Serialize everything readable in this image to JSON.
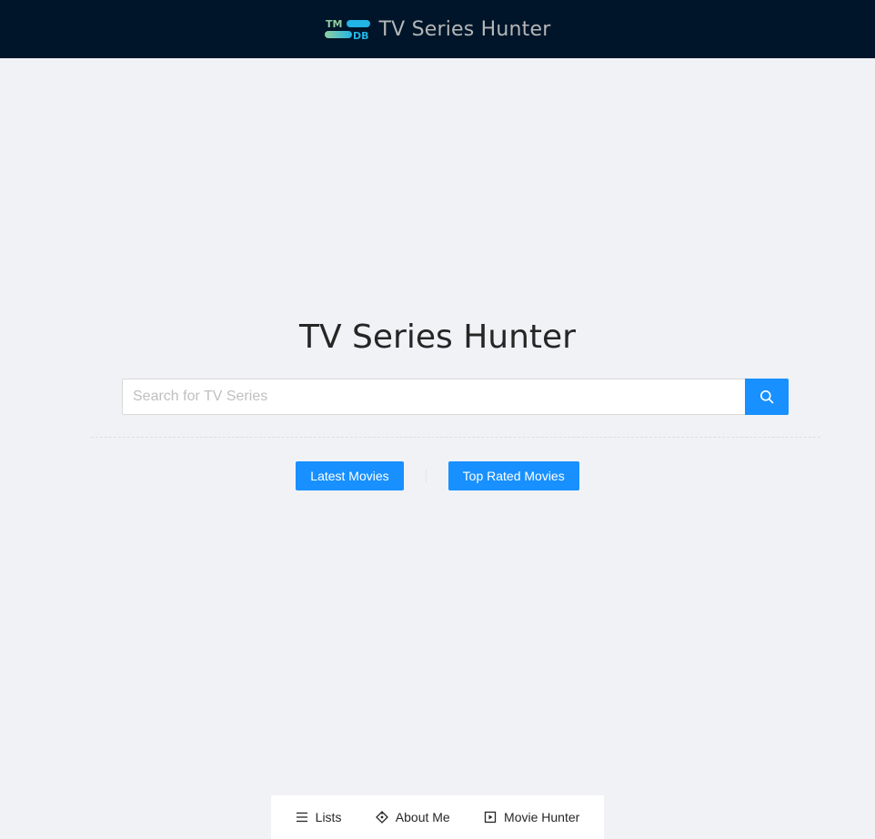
{
  "header": {
    "logo_top_text": "TM",
    "logo_bottom_text": "DB",
    "title": "TV Series Hunter"
  },
  "main": {
    "title": "TV Series Hunter",
    "search": {
      "placeholder": "Search for TV Series",
      "value": "",
      "button_icon": "search-icon"
    },
    "buttons": {
      "latest_label": "Latest Movies",
      "top_rated_label": "Top Rated Movies"
    }
  },
  "footer_nav": {
    "items": [
      {
        "label": "Lists",
        "icon": "menu-icon"
      },
      {
        "label": "About Me",
        "icon": "diamond-icon"
      },
      {
        "label": "Movie Hunter",
        "icon": "play-square-icon"
      }
    ]
  },
  "colors": {
    "header_bg": "#001529",
    "page_bg": "#f0f2f5",
    "primary": "#1890ff",
    "logo_teal": "#4fd1c5",
    "logo_blue": "#22b5e5"
  }
}
